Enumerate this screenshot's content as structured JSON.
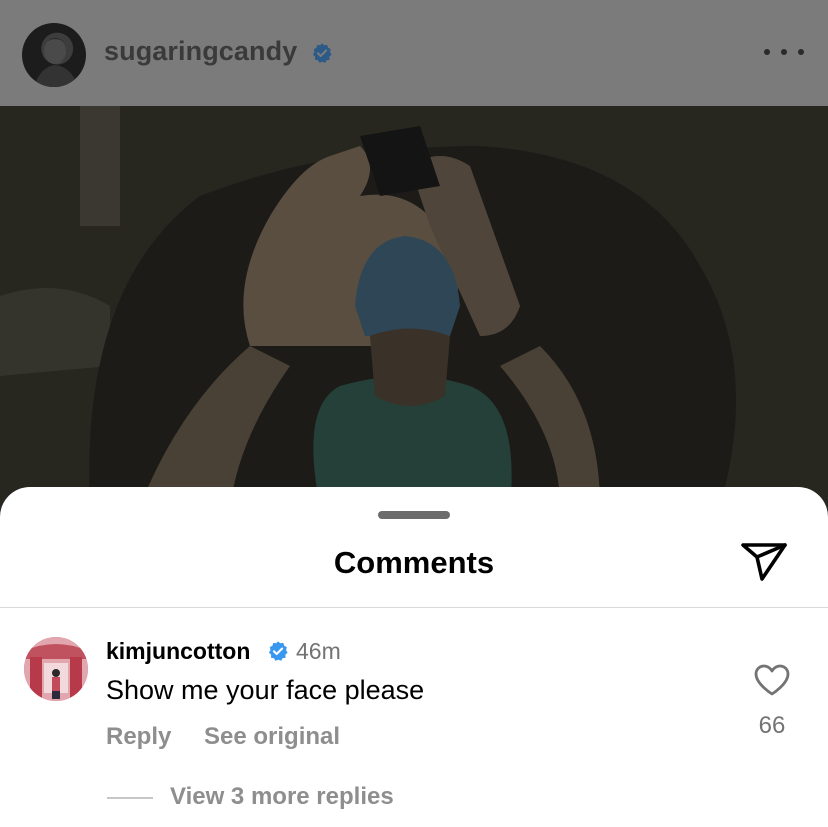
{
  "post": {
    "username": "sugaringcandy",
    "verified": true,
    "more_icon": "ellipsis-icon",
    "photo_description_icon": "photo"
  },
  "comments_sheet": {
    "title": "Comments",
    "share_icon": "paper-plane-icon"
  },
  "comment": {
    "username": "kimjuncotton",
    "verified": true,
    "time": "46m",
    "text": "Show me your face please",
    "reply_label": "Reply",
    "see_original_label": "See original",
    "like_count": "66",
    "view_replies_label": "View 3 more replies"
  },
  "colors": {
    "verified_blue": "#3897f0",
    "secondary_text": "#8e8e8e"
  }
}
